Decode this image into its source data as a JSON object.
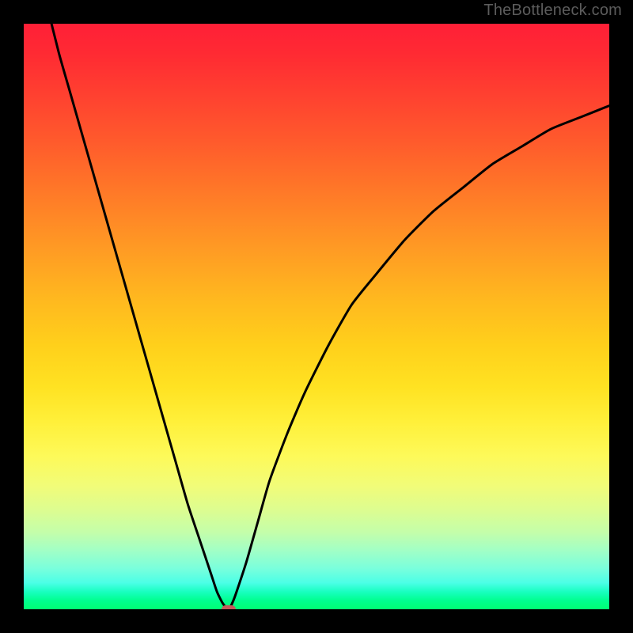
{
  "watermark": "TheBottleneck.com",
  "chart_data": {
    "type": "line",
    "title": "",
    "xlabel": "",
    "ylabel": "",
    "x_range": [
      0,
      100
    ],
    "y_range": [
      0,
      100
    ],
    "grid": false,
    "legend": false,
    "background": {
      "style": "vertical-gradient",
      "stops": [
        {
          "pos": 0,
          "color": "#ff1f37"
        },
        {
          "pos": 50,
          "color": "#ffd01b"
        },
        {
          "pos": 78,
          "color": "#f4fc74"
        },
        {
          "pos": 100,
          "color": "#00ff73"
        }
      ],
      "meaning": "red=high bottleneck, green=low bottleneck"
    },
    "series": [
      {
        "name": "bottleneck-curve",
        "color": "#000000",
        "x": [
          0,
          2,
          4,
          6,
          8,
          10,
          12,
          14,
          16,
          18,
          20,
          22,
          24,
          26,
          28,
          30,
          32,
          33,
          34,
          35,
          36,
          38,
          40,
          42,
          45,
          48,
          52,
          56,
          60,
          65,
          70,
          75,
          80,
          85,
          90,
          95,
          100
        ],
        "y": [
          119,
          111,
          103,
          95,
          88,
          81,
          74,
          67,
          60,
          53,
          46,
          39,
          32,
          25,
          18,
          12,
          6,
          3,
          1,
          0,
          2,
          8,
          15,
          22,
          30,
          37,
          45,
          52,
          57,
          63,
          68,
          72,
          76,
          79,
          82,
          84,
          86
        ]
      }
    ],
    "marker": {
      "name": "optimal-point",
      "x": 35,
      "y": 0,
      "color": "#c45a5a"
    },
    "notes": "V-shaped curve; minimum (optimal point) at x≈35. Left branch descends roughly linearly from above the visible top-left; right branch rises concavely toward ~86 at x=100. Values above 100 on y are clipped outside the plot area."
  }
}
